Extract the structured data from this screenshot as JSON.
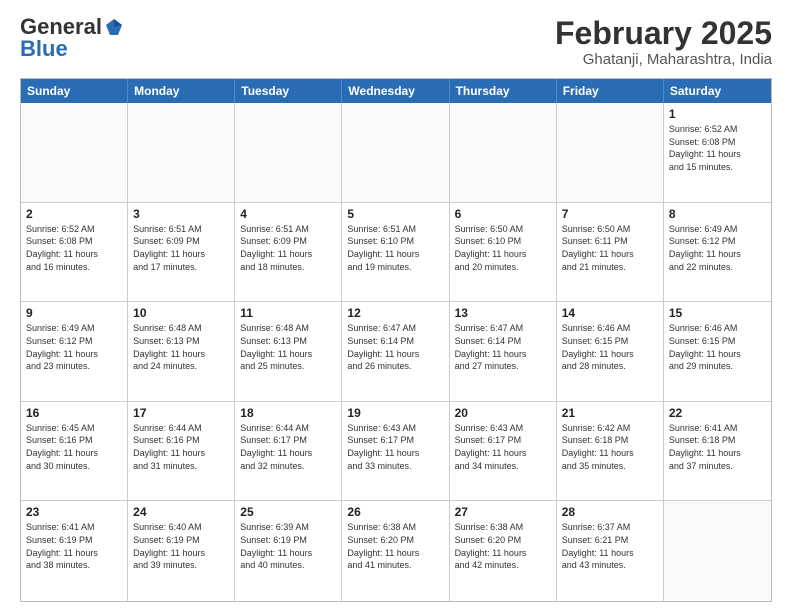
{
  "header": {
    "logo_general": "General",
    "logo_blue": "Blue",
    "month_title": "February 2025",
    "location": "Ghatanji, Maharashtra, India"
  },
  "weekdays": [
    "Sunday",
    "Monday",
    "Tuesday",
    "Wednesday",
    "Thursday",
    "Friday",
    "Saturday"
  ],
  "rows": [
    [
      {
        "day": "",
        "info": ""
      },
      {
        "day": "",
        "info": ""
      },
      {
        "day": "",
        "info": ""
      },
      {
        "day": "",
        "info": ""
      },
      {
        "day": "",
        "info": ""
      },
      {
        "day": "",
        "info": ""
      },
      {
        "day": "1",
        "info": "Sunrise: 6:52 AM\nSunset: 6:08 PM\nDaylight: 11 hours\nand 15 minutes."
      }
    ],
    [
      {
        "day": "2",
        "info": "Sunrise: 6:52 AM\nSunset: 6:08 PM\nDaylight: 11 hours\nand 16 minutes."
      },
      {
        "day": "3",
        "info": "Sunrise: 6:51 AM\nSunset: 6:09 PM\nDaylight: 11 hours\nand 17 minutes."
      },
      {
        "day": "4",
        "info": "Sunrise: 6:51 AM\nSunset: 6:09 PM\nDaylight: 11 hours\nand 18 minutes."
      },
      {
        "day": "5",
        "info": "Sunrise: 6:51 AM\nSunset: 6:10 PM\nDaylight: 11 hours\nand 19 minutes."
      },
      {
        "day": "6",
        "info": "Sunrise: 6:50 AM\nSunset: 6:10 PM\nDaylight: 11 hours\nand 20 minutes."
      },
      {
        "day": "7",
        "info": "Sunrise: 6:50 AM\nSunset: 6:11 PM\nDaylight: 11 hours\nand 21 minutes."
      },
      {
        "day": "8",
        "info": "Sunrise: 6:49 AM\nSunset: 6:12 PM\nDaylight: 11 hours\nand 22 minutes."
      }
    ],
    [
      {
        "day": "9",
        "info": "Sunrise: 6:49 AM\nSunset: 6:12 PM\nDaylight: 11 hours\nand 23 minutes."
      },
      {
        "day": "10",
        "info": "Sunrise: 6:48 AM\nSunset: 6:13 PM\nDaylight: 11 hours\nand 24 minutes."
      },
      {
        "day": "11",
        "info": "Sunrise: 6:48 AM\nSunset: 6:13 PM\nDaylight: 11 hours\nand 25 minutes."
      },
      {
        "day": "12",
        "info": "Sunrise: 6:47 AM\nSunset: 6:14 PM\nDaylight: 11 hours\nand 26 minutes."
      },
      {
        "day": "13",
        "info": "Sunrise: 6:47 AM\nSunset: 6:14 PM\nDaylight: 11 hours\nand 27 minutes."
      },
      {
        "day": "14",
        "info": "Sunrise: 6:46 AM\nSunset: 6:15 PM\nDaylight: 11 hours\nand 28 minutes."
      },
      {
        "day": "15",
        "info": "Sunrise: 6:46 AM\nSunset: 6:15 PM\nDaylight: 11 hours\nand 29 minutes."
      }
    ],
    [
      {
        "day": "16",
        "info": "Sunrise: 6:45 AM\nSunset: 6:16 PM\nDaylight: 11 hours\nand 30 minutes."
      },
      {
        "day": "17",
        "info": "Sunrise: 6:44 AM\nSunset: 6:16 PM\nDaylight: 11 hours\nand 31 minutes."
      },
      {
        "day": "18",
        "info": "Sunrise: 6:44 AM\nSunset: 6:17 PM\nDaylight: 11 hours\nand 32 minutes."
      },
      {
        "day": "19",
        "info": "Sunrise: 6:43 AM\nSunset: 6:17 PM\nDaylight: 11 hours\nand 33 minutes."
      },
      {
        "day": "20",
        "info": "Sunrise: 6:43 AM\nSunset: 6:17 PM\nDaylight: 11 hours\nand 34 minutes."
      },
      {
        "day": "21",
        "info": "Sunrise: 6:42 AM\nSunset: 6:18 PM\nDaylight: 11 hours\nand 35 minutes."
      },
      {
        "day": "22",
        "info": "Sunrise: 6:41 AM\nSunset: 6:18 PM\nDaylight: 11 hours\nand 37 minutes."
      }
    ],
    [
      {
        "day": "23",
        "info": "Sunrise: 6:41 AM\nSunset: 6:19 PM\nDaylight: 11 hours\nand 38 minutes."
      },
      {
        "day": "24",
        "info": "Sunrise: 6:40 AM\nSunset: 6:19 PM\nDaylight: 11 hours\nand 39 minutes."
      },
      {
        "day": "25",
        "info": "Sunrise: 6:39 AM\nSunset: 6:19 PM\nDaylight: 11 hours\nand 40 minutes."
      },
      {
        "day": "26",
        "info": "Sunrise: 6:38 AM\nSunset: 6:20 PM\nDaylight: 11 hours\nand 41 minutes."
      },
      {
        "day": "27",
        "info": "Sunrise: 6:38 AM\nSunset: 6:20 PM\nDaylight: 11 hours\nand 42 minutes."
      },
      {
        "day": "28",
        "info": "Sunrise: 6:37 AM\nSunset: 6:21 PM\nDaylight: 11 hours\nand 43 minutes."
      },
      {
        "day": "",
        "info": ""
      }
    ]
  ]
}
